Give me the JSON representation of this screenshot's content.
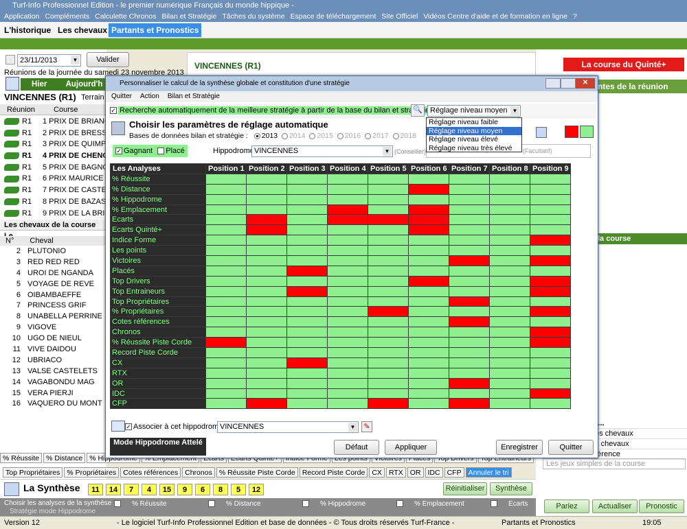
{
  "window_title": "Turf-Info Professionnel Edition - le premier numérique Français du monde hippique -",
  "menu": [
    "Application",
    "Compléments",
    "Calculette Chronos",
    "Bilan et Stratégie",
    "Tâches du système",
    "Espace de téléchargement",
    "Site Officiel",
    "Vidéos Centre d'aide et de formation en ligne",
    "?"
  ],
  "tabs": {
    "historique": "L'historique",
    "chevaux": "Les chevaux",
    "partants": "Partants et Pronostics"
  },
  "left": {
    "date": "23/11/2013",
    "valider": "Valider",
    "reunions_label": "Réunions de la journée du samedi 23 novembre 2013",
    "hier": "Hier",
    "aujourdhui": "Aujourd'h",
    "meeting": "VINCENNES (R1)",
    "terrain": "Terrain",
    "col_reunion": "Réunion",
    "col_course": "Course",
    "races": [
      {
        "r": "R1",
        "c": "1 PRIX DE BRIANÇ"
      },
      {
        "r": "R1",
        "c": "2 PRIX DE BRESS"
      },
      {
        "r": "R1",
        "c": "3 PRIX DE QUIMP"
      },
      {
        "r": "R1",
        "c": "4 PRIX DE CHENO",
        "bold": true
      },
      {
        "r": "R1",
        "c": "5 PRIX DE BAGNO"
      },
      {
        "r": "R1",
        "c": "6 PRIX MAURICE"
      },
      {
        "r": "R1",
        "c": "7 PRIX DE CASTE"
      },
      {
        "r": "R1",
        "c": "8 PRIX DE BAZAS"
      },
      {
        "r": "R1",
        "c": "9 PRIX DE LA BRI"
      }
    ],
    "chevaux_tab": "Les chevaux de la course",
    "chevaux_tab2": "Le",
    "col_no": "N°",
    "col_cheval": "Cheval",
    "horses": [
      "PLUTONIO",
      "RED RED RED",
      "UROI DE NGANDA",
      "VOYAGE DE REVE",
      "OIBAMBAEFFE",
      "PRINCESS GRIF",
      "UNABELLA PERRINE",
      "VIGOVE",
      "UGO DE NIEUL",
      "VIVE DAIDOU",
      "UBRIACO",
      "VALSE CASTELETS",
      "VAGABONDU MAG",
      "VERA PIERJI",
      "VAQUERO DU MONT"
    ]
  },
  "center_title": "VINCENNES (R1)",
  "right": {
    "quinte": "La course du Quinté+",
    "reunion": "ntes de la réunion",
    "course_header": "la course",
    "items": [
      "tir...",
      "des chevaux",
      "es chevaux",
      "éférence"
    ],
    "jeux": "Les jeux simples de la course",
    "pariez": "Pariez",
    "actualiser": "Actualiser",
    "pronostic": "Pronostic"
  },
  "dialog": {
    "title": "Personnaliser le calcul de la synthèse globale et constitution d'une stratégie",
    "menu": [
      "Quitter",
      "Action",
      "Bilan et Stratégie"
    ],
    "auto_label": "Recherche automatiquement de la meilleure stratégie à partir de la base du bilan et stratégie",
    "level_selected": "Réglage niveau moyen",
    "level_options": [
      "Réglage niveau faible",
      "Réglage niveau moyen",
      "Réglage niveau élevé",
      "Réglage niveau très élevé"
    ],
    "heading": "Choisir les paramètres de réglage automatique",
    "bases_label": "Bases de données bilan et stratégie :",
    "years": [
      "2013",
      "2014",
      "2015",
      "2016",
      "2017",
      "2018"
    ],
    "gagnant": "Gagnant",
    "place": "Placé",
    "hippodrome_label": "Hippodrome",
    "hippodrome": "VINCENNES",
    "conseiller": "(Conseiller)",
    "facultatif": "(Facultatif)",
    "grid_header": "Les Analyses",
    "positions": [
      "Position 1",
      "Position 2",
      "Position 3",
      "Position 4",
      "Position 5",
      "Position 6",
      "Position 7",
      "Position 8",
      "Position 9"
    ],
    "analyses": [
      {
        "name": "% Réussite",
        "red": []
      },
      {
        "name": "% Distance",
        "red": [
          6
        ]
      },
      {
        "name": "% Hippodrome",
        "red": []
      },
      {
        "name": "% Emplacement",
        "red": [
          4,
          6
        ]
      },
      {
        "name": "Ecarts",
        "red": [
          2,
          4,
          5,
          6
        ]
      },
      {
        "name": "Ecarts Quinté+",
        "red": [
          2,
          6
        ]
      },
      {
        "name": "Indice Forme",
        "red": [
          9
        ]
      },
      {
        "name": "Les points",
        "red": []
      },
      {
        "name": "Victoires",
        "red": [
          7,
          9
        ]
      },
      {
        "name": "Placés",
        "red": [
          3
        ]
      },
      {
        "name": "Top Drivers",
        "red": [
          6,
          9
        ]
      },
      {
        "name": "Top Entraineurs",
        "red": [
          3,
          9
        ]
      },
      {
        "name": "Top Propriétaires",
        "red": [
          7
        ]
      },
      {
        "name": "% Propriétaires",
        "red": [
          5,
          9
        ]
      },
      {
        "name": "Cotes références",
        "red": [
          7
        ]
      },
      {
        "name": "Chronos",
        "red": [
          9
        ]
      },
      {
        "name": "% Réussite Piste Corde",
        "red": [
          1,
          9
        ]
      },
      {
        "name": "Record Piste Corde",
        "red": []
      },
      {
        "name": "CX",
        "red": [
          3
        ]
      },
      {
        "name": "RTX",
        "red": []
      },
      {
        "name": "OR",
        "red": [
          7
        ]
      },
      {
        "name": "IDC",
        "red": [
          9
        ]
      },
      {
        "name": "CFP",
        "red": [
          2,
          5,
          7
        ]
      }
    ],
    "associer": "Associer à cet hippodrome",
    "associer_value": "VINCENNES",
    "mode": "Mode Hippodrome Attelé",
    "defaut": "Défaut",
    "appliquer": "Appliquer",
    "enregistrer": "Enregistrer",
    "quitter": "Quitter"
  },
  "bottom": {
    "tabs1": [
      "% Réussite",
      "% Distance",
      "% Hippodrome",
      "% Emplacement",
      "Ecarts",
      "Ecarts Quinté+",
      "Indice Forme",
      "Les points",
      "Victoires",
      "Placés",
      "Top Drivers",
      "Top Entraineurs"
    ],
    "tabs2": [
      "Top Propriétaires",
      "% Propriétaires",
      "Cotes références",
      "Chronos",
      "% Réussite Piste Corde",
      "Record Piste Corde",
      "CX",
      "RTX",
      "OR",
      "IDC",
      "CFP"
    ],
    "annuler": "Annuler le tri",
    "synthese_title": "La Synthèse",
    "numbers": [
      "11",
      "14",
      "7",
      "4",
      "15",
      "9",
      "6",
      "8",
      "5",
      "12"
    ],
    "reinit": "Réinitialiser",
    "synthese": "Synthèse",
    "choisir": "Choisir les analyses de la synthèse :",
    "strategie": "Stratégie mode Hippodrome",
    "checks": [
      "% Réussite",
      "% Distance",
      "% Hippodrome",
      "% Emplacement",
      "Ecarts"
    ]
  },
  "status": {
    "version": "Version 12",
    "center": "- Le logiciel Turf-Info Professionnel Edition et base de données - © Tous droits réservés Turf-France -",
    "section": "Partants et Pronostics",
    "time": "19:05"
  }
}
